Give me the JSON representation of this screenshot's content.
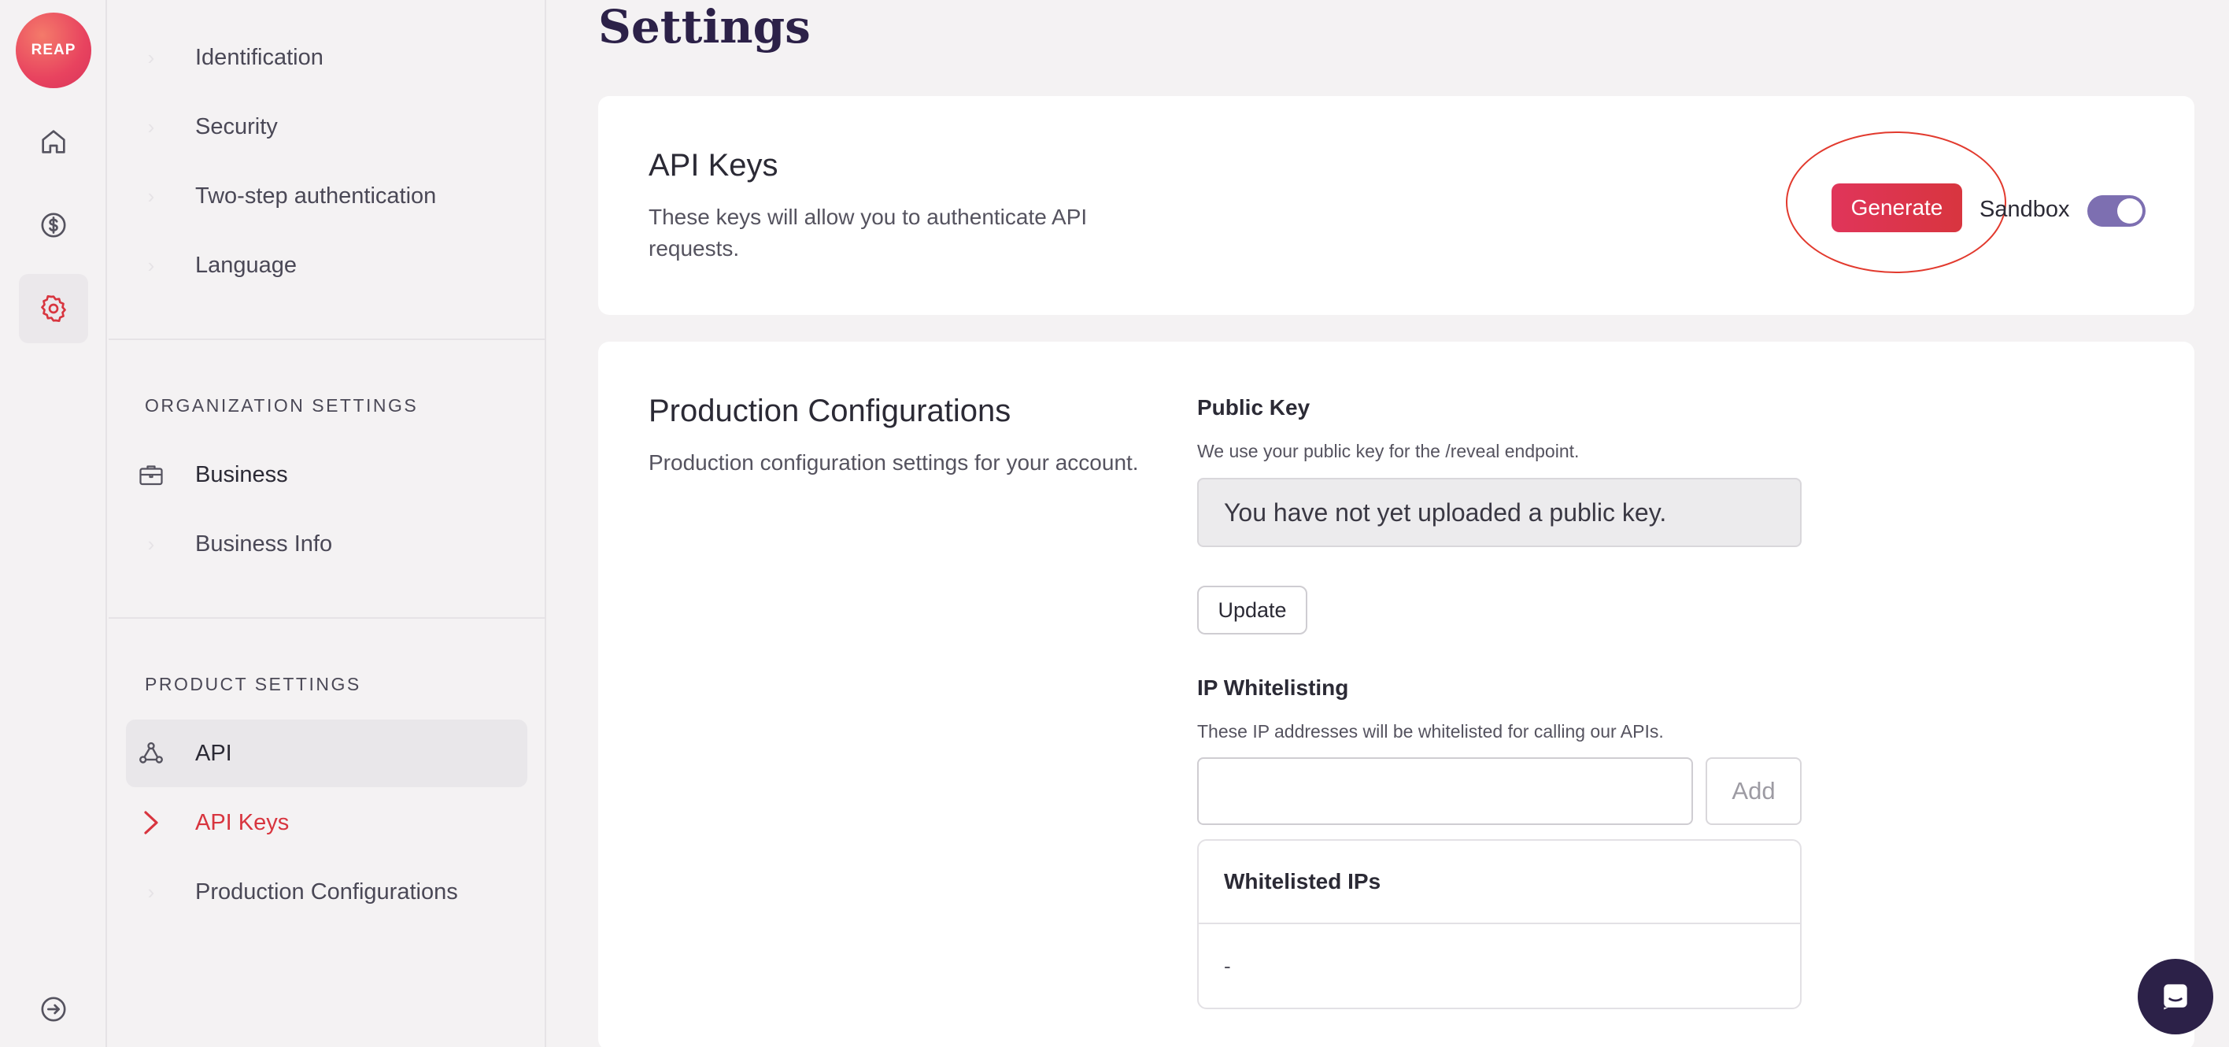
{
  "rail": {
    "logo_text": "REAP",
    "items": [
      {
        "icon": "home-icon"
      },
      {
        "icon": "dollar-icon"
      },
      {
        "icon": "gear-icon",
        "active": true
      }
    ],
    "bottom_icon": "logout-icon"
  },
  "sidebar": {
    "account_items": [
      {
        "label": "Identification"
      },
      {
        "label": "Security"
      },
      {
        "label": "Two-step authentication"
      },
      {
        "label": "Language"
      }
    ],
    "org_section": {
      "title": "ORGANIZATION SETTINGS",
      "group_label": "Business",
      "items": [
        {
          "label": "Business Info"
        }
      ]
    },
    "product_section": {
      "title": "PRODUCT SETTINGS",
      "group_label": "API",
      "items": [
        {
          "label": "API Keys",
          "active": true
        },
        {
          "label": "Production Configurations"
        }
      ]
    }
  },
  "main": {
    "page_title": "Settings",
    "api_keys": {
      "title": "API Keys",
      "description": "These keys will allow you to authenticate API requests.",
      "generate_label": "Generate",
      "sandbox_label": "Sandbox",
      "sandbox_on": true
    },
    "production": {
      "title": "Production Configurations",
      "description": "Production configuration settings for your account.",
      "public_key": {
        "label": "Public Key",
        "help": "We use your public key for the /reveal endpoint.",
        "value": "You have not yet uploaded a public key.",
        "update_label": "Update"
      },
      "ip_whitelisting": {
        "label": "IP Whitelisting",
        "help": "These IP addresses will be whitelisted for calling our APIs.",
        "input_value": "",
        "add_label": "Add",
        "table_header": "Whitelisted IPs",
        "rows": [
          "-"
        ]
      }
    }
  },
  "colors": {
    "accent_red": "#d8353f",
    "title_purple": "#2c2148",
    "toggle_purple": "#7d6fb1"
  }
}
